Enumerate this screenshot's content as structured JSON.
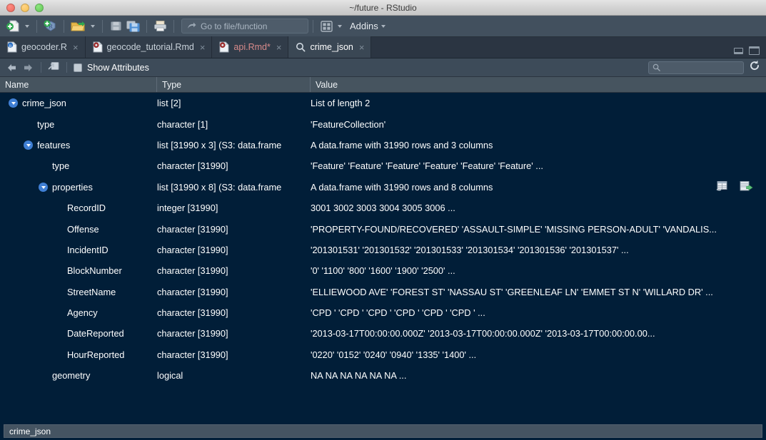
{
  "window": {
    "title": "~/future - RStudio",
    "traffic_lights": [
      "close",
      "minimize",
      "zoom"
    ]
  },
  "toolbar": {
    "new_file_label": "new-file",
    "new_project_label": "new-project",
    "open_file_label": "open-file",
    "save_label": "save",
    "save_all_label": "save-all",
    "print_label": "print",
    "goto_placeholder": "Go to file/function",
    "panes_label": "workspace-panes",
    "addins_label": "Addins"
  },
  "tabs": [
    {
      "label": "geocoder.R",
      "icon": "r-script-icon",
      "active": false,
      "modified": false,
      "closeable": true
    },
    {
      "label": "geocode_tutorial.Rmd",
      "icon": "rmarkdown-icon",
      "active": false,
      "modified": false,
      "closeable": true
    },
    {
      "label": "api.Rmd*",
      "icon": "rmarkdown-icon",
      "active": false,
      "modified": true,
      "closeable": true
    },
    {
      "label": "crime_json",
      "icon": "search-icon",
      "active": true,
      "modified": false,
      "closeable": true
    }
  ],
  "pane_controls": {
    "minimize_label": "minimize-pane",
    "maximize_label": "maximize-pane"
  },
  "explorer_toolbar": {
    "back_label": "back",
    "forward_label": "forward",
    "popout_label": "show-in-new-window",
    "show_attributes_label": "Show Attributes",
    "show_attributes_checked": false,
    "search_value": "",
    "search_placeholder": "",
    "refresh_label": "refresh"
  },
  "grid": {
    "columns": [
      "Name",
      "Type",
      "Value"
    ],
    "rows": [
      {
        "indent": 0,
        "expandable": true,
        "expanded": true,
        "name": "crime_json",
        "type": "list [2]",
        "value": "List of length 2"
      },
      {
        "indent": 1,
        "expandable": false,
        "expanded": false,
        "name": "type",
        "type": "character [1]",
        "value": "'FeatureCollection'"
      },
      {
        "indent": 1,
        "expandable": true,
        "expanded": true,
        "name": "features",
        "type": "list [31990 x 3] (S3: data.frame",
        "value": "A data.frame with 31990 rows and 3 columns"
      },
      {
        "indent": 2,
        "expandable": false,
        "expanded": false,
        "name": "type",
        "type": "character [31990]",
        "value": "'Feature' 'Feature' 'Feature' 'Feature' 'Feature' 'Feature' ..."
      },
      {
        "indent": 2,
        "expandable": true,
        "expanded": true,
        "name": "properties",
        "type": "list [31990 x 8] (S3: data.frame",
        "value": "A data.frame with 31990 rows and 8 columns",
        "icons": [
          "view-table-icon",
          "export-data-icon"
        ]
      },
      {
        "indent": 3,
        "expandable": false,
        "expanded": false,
        "name": "RecordID",
        "type": "integer [31990]",
        "value": "3001 3002 3003 3004 3005 3006 ..."
      },
      {
        "indent": 3,
        "expandable": false,
        "expanded": false,
        "name": "Offense",
        "type": "character [31990]",
        "value": "'PROPERTY-FOUND/RECOVERED' 'ASSAULT-SIMPLE' 'MISSING PERSON-ADULT' 'VANDALIS..."
      },
      {
        "indent": 3,
        "expandable": false,
        "expanded": false,
        "name": "IncidentID",
        "type": "character [31990]",
        "value": "'201301531' '201301532' '201301533' '201301534' '201301536' '201301537' ..."
      },
      {
        "indent": 3,
        "expandable": false,
        "expanded": false,
        "name": "BlockNumber",
        "type": "character [31990]",
        "value": "'0' '1100' '800' '1600' '1900' '2500' ..."
      },
      {
        "indent": 3,
        "expandable": false,
        "expanded": false,
        "name": "StreetName",
        "type": "character [31990]",
        "value": "'ELLIEWOOD AVE' 'FOREST ST' 'NASSAU ST' 'GREENLEAF LN' 'EMMET ST N' 'WILLARD DR' ..."
      },
      {
        "indent": 3,
        "expandable": false,
        "expanded": false,
        "name": "Agency",
        "type": "character [31990]",
        "value": "'CPD ' 'CPD ' 'CPD ' 'CPD ' 'CPD ' 'CPD ' ..."
      },
      {
        "indent": 3,
        "expandable": false,
        "expanded": false,
        "name": "DateReported",
        "type": "character [31990]",
        "value": "'2013-03-17T00:00:00.000Z' '2013-03-17T00:00:00.000Z' '2013-03-17T00:00:00.00..."
      },
      {
        "indent": 3,
        "expandable": false,
        "expanded": false,
        "name": "HourReported",
        "type": "character [31990]",
        "value": "'0220' '0152' '0240' '0940' '1335' '1400' ..."
      },
      {
        "indent": 2,
        "expandable": false,
        "expanded": false,
        "name": "geometry",
        "type": "logical",
        "value": "NA NA NA NA NA NA ..."
      }
    ]
  },
  "statusbar": {
    "text": "crime_json"
  },
  "colors": {
    "titlebar": "#d8d8d8",
    "toolbar": "#42505e",
    "tabbar": "#2b3542",
    "tab_active": "#3a4754",
    "grid_header": "#46545f",
    "content_bg": "#011e38",
    "status_chip": "#455462",
    "twisty_blue": "#3f7fd4",
    "text": "#ffffff"
  }
}
